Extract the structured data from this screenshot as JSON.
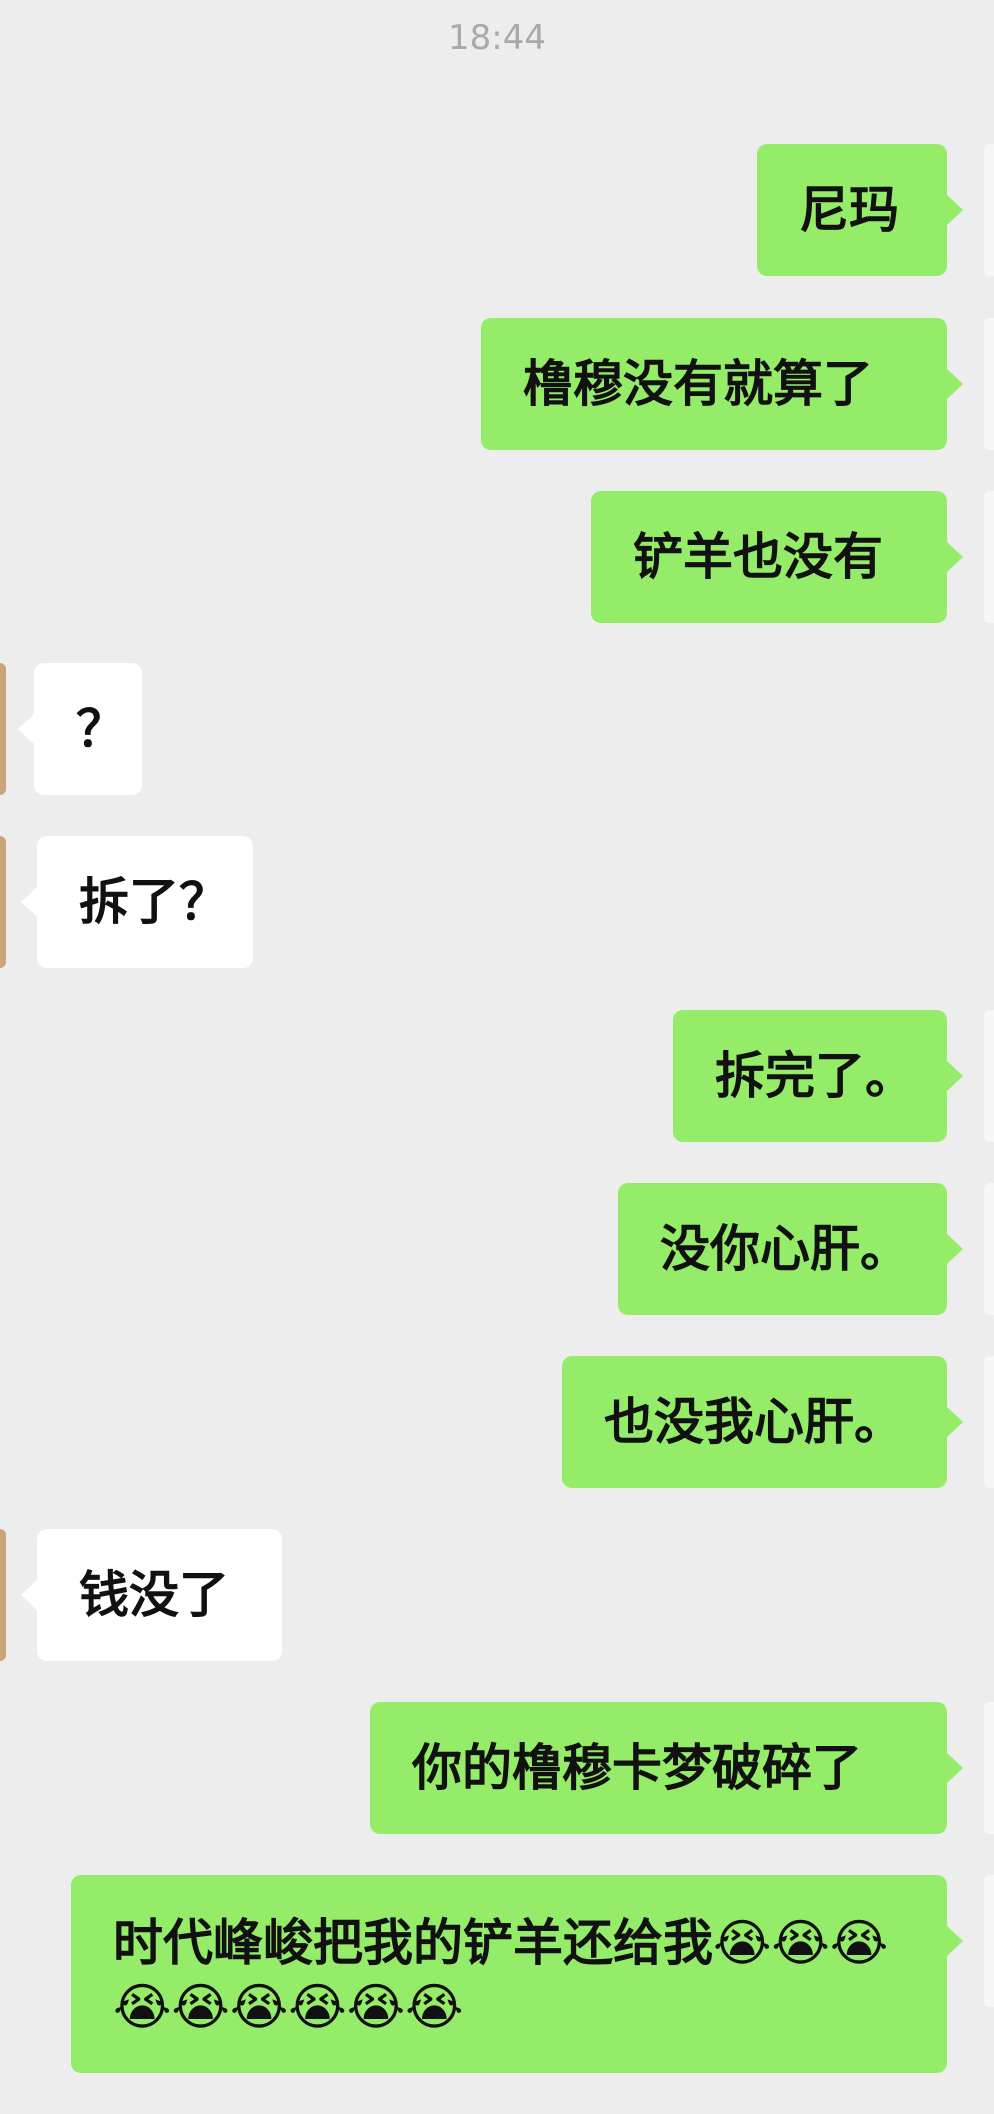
{
  "status": {
    "time": "18:44"
  },
  "messages": [
    {
      "side": "right",
      "text": "尼玛"
    },
    {
      "side": "right",
      "text": "橹穆没有就算了"
    },
    {
      "side": "right",
      "text": "铲羊也没有"
    },
    {
      "side": "left",
      "text": "？"
    },
    {
      "side": "left",
      "text": "拆了？"
    },
    {
      "side": "right",
      "text": "拆完了。"
    },
    {
      "side": "right",
      "text": "没你心肝。"
    },
    {
      "side": "right",
      "text": "也没我心肝。"
    },
    {
      "side": "left",
      "text": "钱没了"
    },
    {
      "side": "right",
      "text": "你的橹穆卡梦破碎了"
    },
    {
      "side": "right",
      "text": "时代峰峻把我的铲羊还给我😭😭😭😭😭😭😭😭😭"
    }
  ]
}
